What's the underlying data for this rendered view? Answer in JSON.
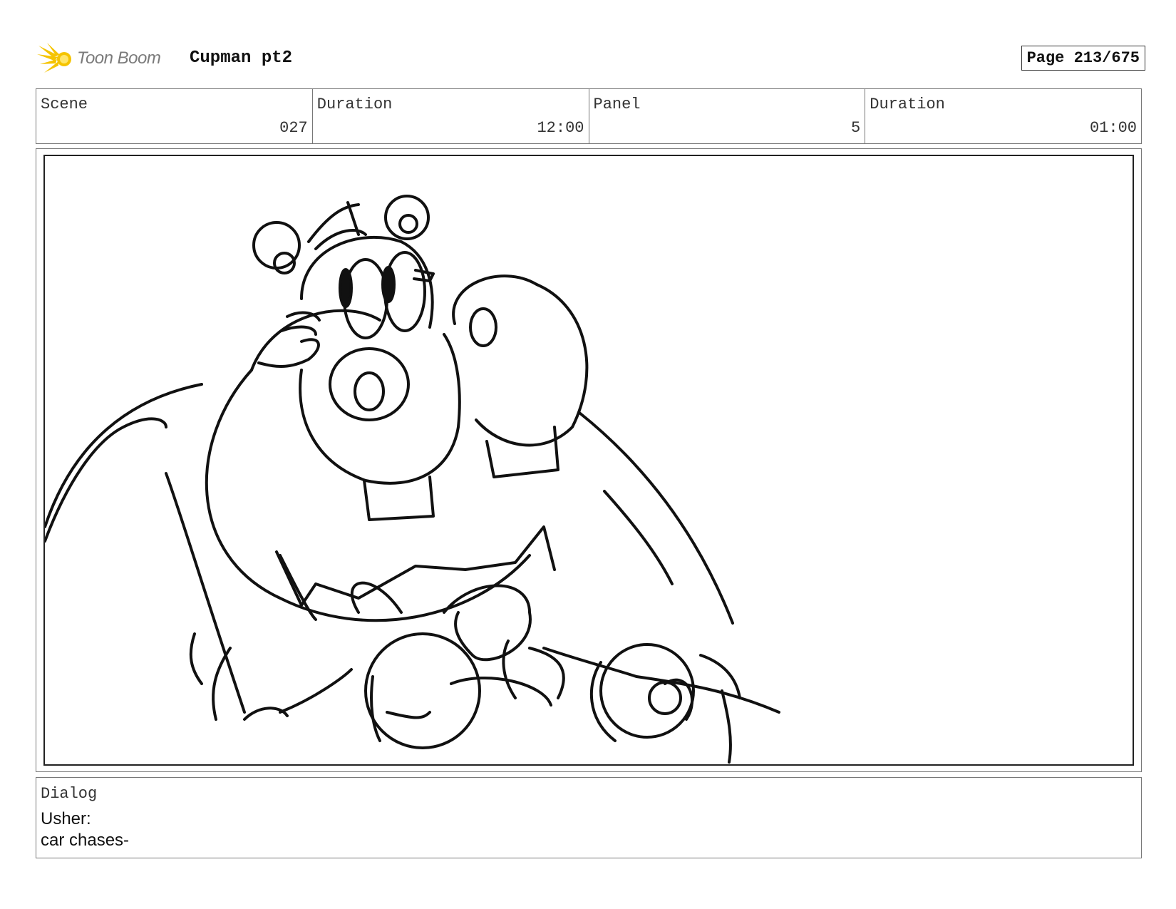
{
  "header": {
    "logo_text": "Toon Boom",
    "project_title": "Cupman pt2",
    "page_label": "Page 213/675"
  },
  "info": {
    "scene_label": "Scene",
    "scene_value": "027",
    "scene_duration_label": "Duration",
    "scene_duration_value": "12:00",
    "panel_label": "Panel",
    "panel_value": "5",
    "panel_duration_label": "Duration",
    "panel_duration_value": "01:00"
  },
  "dialog": {
    "label": "Dialog",
    "lines": [
      "Usher:",
      "car chases-"
    ]
  },
  "colors": {
    "logo_accent": "#f5c400",
    "logo_text": "#7a7a7a"
  },
  "icons": {
    "logo": "toon-boom-sunburst-icon"
  }
}
